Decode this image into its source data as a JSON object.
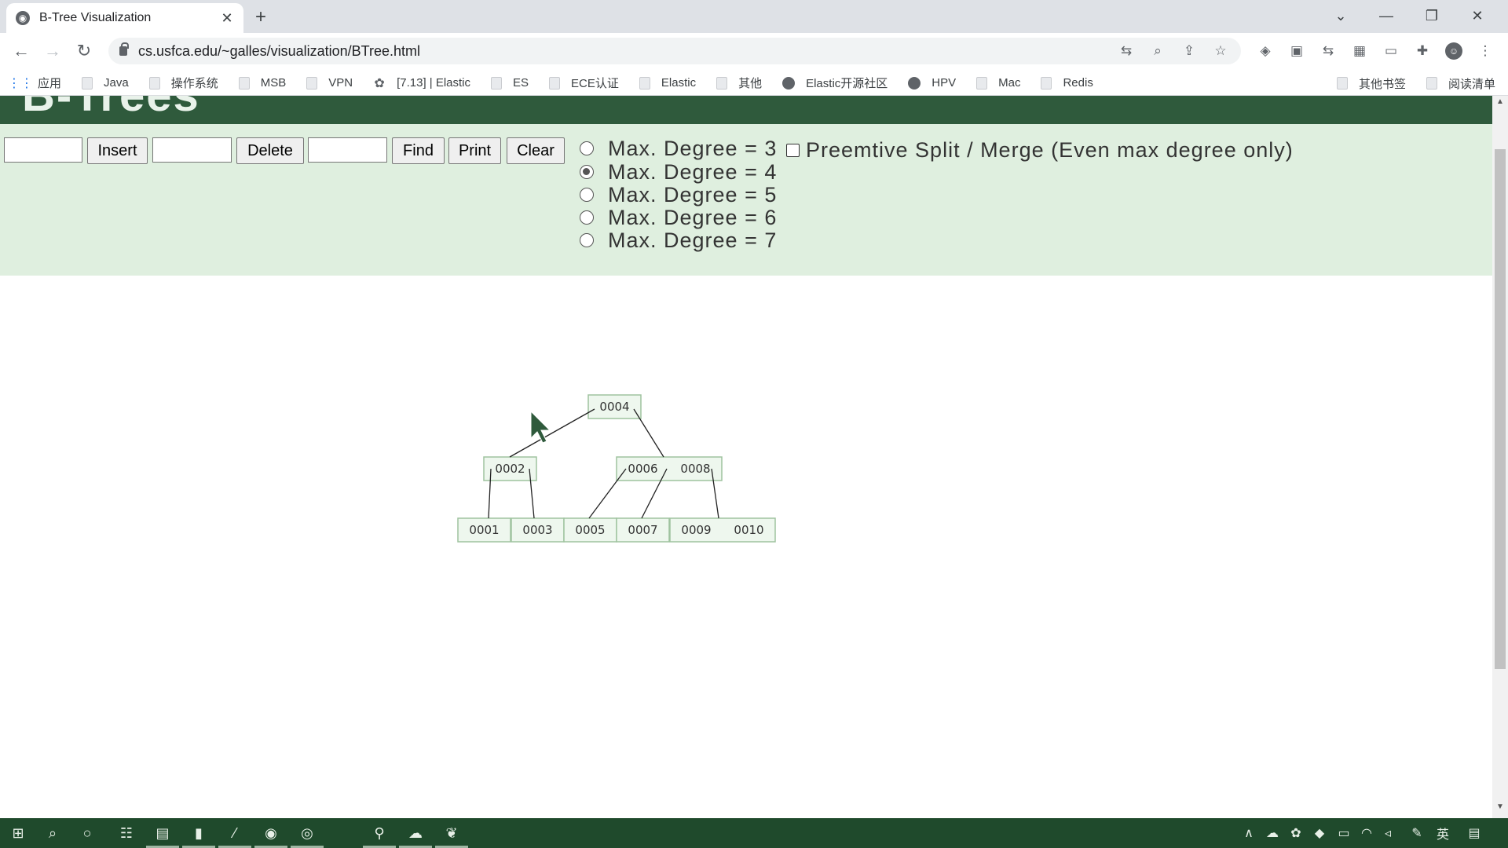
{
  "browser": {
    "tab_title": "B-Tree Visualization",
    "url": "cs.usfca.edu/~galles/visualization/BTree.html",
    "bookmarks": [
      {
        "label": "应用",
        "icon": "apps-grid-icon"
      },
      {
        "label": "Java",
        "icon": "folder-icon"
      },
      {
        "label": "操作系统",
        "icon": "folder-icon"
      },
      {
        "label": "MSB",
        "icon": "folder-icon"
      },
      {
        "label": "VPN",
        "icon": "folder-icon"
      },
      {
        "label": "[7.13] | Elastic",
        "icon": "cluster-icon"
      },
      {
        "label": "ES",
        "icon": "folder-icon"
      },
      {
        "label": "ECE认证",
        "icon": "folder-icon"
      },
      {
        "label": "Elastic",
        "icon": "folder-icon"
      },
      {
        "label": "其他",
        "icon": "folder-icon"
      },
      {
        "label": "Elastic开源社区",
        "icon": "globe-icon"
      },
      {
        "label": "HPV",
        "icon": "globe-icon"
      },
      {
        "label": "Mac",
        "icon": "folder-icon"
      },
      {
        "label": "Redis",
        "icon": "folder-icon"
      }
    ],
    "bookmarks_right": [
      {
        "label": "其他书签",
        "icon": "folder-icon"
      },
      {
        "label": "阅读清单",
        "icon": "reading-list-icon"
      }
    ]
  },
  "page": {
    "header_title": "B-Trees",
    "controls": {
      "insert_value": "",
      "insert_label": "Insert",
      "delete_value": "",
      "delete_label": "Delete",
      "find_value": "",
      "find_label": "Find",
      "print_label": "Print",
      "clear_label": "Clear",
      "degree_options": [
        {
          "label": "Max. Degree = 3",
          "selected": false
        },
        {
          "label": "Max. Degree = 4",
          "selected": true
        },
        {
          "label": "Max. Degree = 5",
          "selected": false
        },
        {
          "label": "Max. Degree = 6",
          "selected": false
        },
        {
          "label": "Max. Degree = 7",
          "selected": false
        }
      ],
      "preemptive_label": "Preemtive Split / Merge (Even max degree only)",
      "preemptive_checked": false
    },
    "tree": {
      "root": {
        "keys": [
          "0004"
        ]
      },
      "level1": [
        {
          "keys": [
            "0002"
          ]
        },
        {
          "keys": [
            "0006",
            "0008"
          ]
        }
      ],
      "leaves": [
        {
          "keys": [
            "0001"
          ]
        },
        {
          "keys": [
            "0003"
          ]
        },
        {
          "keys": [
            "0005"
          ]
        },
        {
          "keys": [
            "0007"
          ]
        },
        {
          "keys": [
            "0009",
            "0010"
          ]
        }
      ]
    }
  },
  "taskbar": {
    "ime_label": "英"
  },
  "colors": {
    "header_green": "#2f5a3c",
    "controls_bg": "#dfefdf",
    "node_fill": "#eef7ee",
    "node_stroke": "#9fc39f",
    "taskbar": "#1f4a2c"
  }
}
